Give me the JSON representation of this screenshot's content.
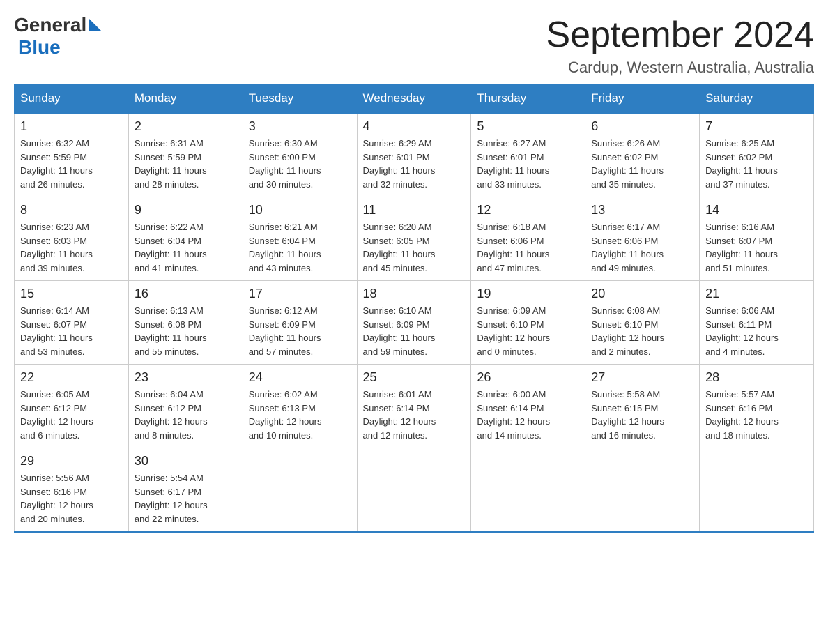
{
  "header": {
    "logo_general": "General",
    "logo_blue": "Blue",
    "main_title": "September 2024",
    "subtitle": "Cardup, Western Australia, Australia"
  },
  "calendar": {
    "weekdays": [
      "Sunday",
      "Monday",
      "Tuesday",
      "Wednesday",
      "Thursday",
      "Friday",
      "Saturday"
    ],
    "weeks": [
      [
        {
          "day": "1",
          "sunrise": "6:32 AM",
          "sunset": "5:59 PM",
          "daylight": "11 hours and 26 minutes."
        },
        {
          "day": "2",
          "sunrise": "6:31 AM",
          "sunset": "5:59 PM",
          "daylight": "11 hours and 28 minutes."
        },
        {
          "day": "3",
          "sunrise": "6:30 AM",
          "sunset": "6:00 PM",
          "daylight": "11 hours and 30 minutes."
        },
        {
          "day": "4",
          "sunrise": "6:29 AM",
          "sunset": "6:01 PM",
          "daylight": "11 hours and 32 minutes."
        },
        {
          "day": "5",
          "sunrise": "6:27 AM",
          "sunset": "6:01 PM",
          "daylight": "11 hours and 33 minutes."
        },
        {
          "day": "6",
          "sunrise": "6:26 AM",
          "sunset": "6:02 PM",
          "daylight": "11 hours and 35 minutes."
        },
        {
          "day": "7",
          "sunrise": "6:25 AM",
          "sunset": "6:02 PM",
          "daylight": "11 hours and 37 minutes."
        }
      ],
      [
        {
          "day": "8",
          "sunrise": "6:23 AM",
          "sunset": "6:03 PM",
          "daylight": "11 hours and 39 minutes."
        },
        {
          "day": "9",
          "sunrise": "6:22 AM",
          "sunset": "6:04 PM",
          "daylight": "11 hours and 41 minutes."
        },
        {
          "day": "10",
          "sunrise": "6:21 AM",
          "sunset": "6:04 PM",
          "daylight": "11 hours and 43 minutes."
        },
        {
          "day": "11",
          "sunrise": "6:20 AM",
          "sunset": "6:05 PM",
          "daylight": "11 hours and 45 minutes."
        },
        {
          "day": "12",
          "sunrise": "6:18 AM",
          "sunset": "6:06 PM",
          "daylight": "11 hours and 47 minutes."
        },
        {
          "day": "13",
          "sunrise": "6:17 AM",
          "sunset": "6:06 PM",
          "daylight": "11 hours and 49 minutes."
        },
        {
          "day": "14",
          "sunrise": "6:16 AM",
          "sunset": "6:07 PM",
          "daylight": "11 hours and 51 minutes."
        }
      ],
      [
        {
          "day": "15",
          "sunrise": "6:14 AM",
          "sunset": "6:07 PM",
          "daylight": "11 hours and 53 minutes."
        },
        {
          "day": "16",
          "sunrise": "6:13 AM",
          "sunset": "6:08 PM",
          "daylight": "11 hours and 55 minutes."
        },
        {
          "day": "17",
          "sunrise": "6:12 AM",
          "sunset": "6:09 PM",
          "daylight": "11 hours and 57 minutes."
        },
        {
          "day": "18",
          "sunrise": "6:10 AM",
          "sunset": "6:09 PM",
          "daylight": "11 hours and 59 minutes."
        },
        {
          "day": "19",
          "sunrise": "6:09 AM",
          "sunset": "6:10 PM",
          "daylight": "12 hours and 0 minutes."
        },
        {
          "day": "20",
          "sunrise": "6:08 AM",
          "sunset": "6:10 PM",
          "daylight": "12 hours and 2 minutes."
        },
        {
          "day": "21",
          "sunrise": "6:06 AM",
          "sunset": "6:11 PM",
          "daylight": "12 hours and 4 minutes."
        }
      ],
      [
        {
          "day": "22",
          "sunrise": "6:05 AM",
          "sunset": "6:12 PM",
          "daylight": "12 hours and 6 minutes."
        },
        {
          "day": "23",
          "sunrise": "6:04 AM",
          "sunset": "6:12 PM",
          "daylight": "12 hours and 8 minutes."
        },
        {
          "day": "24",
          "sunrise": "6:02 AM",
          "sunset": "6:13 PM",
          "daylight": "12 hours and 10 minutes."
        },
        {
          "day": "25",
          "sunrise": "6:01 AM",
          "sunset": "6:14 PM",
          "daylight": "12 hours and 12 minutes."
        },
        {
          "day": "26",
          "sunrise": "6:00 AM",
          "sunset": "6:14 PM",
          "daylight": "12 hours and 14 minutes."
        },
        {
          "day": "27",
          "sunrise": "5:58 AM",
          "sunset": "6:15 PM",
          "daylight": "12 hours and 16 minutes."
        },
        {
          "day": "28",
          "sunrise": "5:57 AM",
          "sunset": "6:16 PM",
          "daylight": "12 hours and 18 minutes."
        }
      ],
      [
        {
          "day": "29",
          "sunrise": "5:56 AM",
          "sunset": "6:16 PM",
          "daylight": "12 hours and 20 minutes."
        },
        {
          "day": "30",
          "sunrise": "5:54 AM",
          "sunset": "6:17 PM",
          "daylight": "12 hours and 22 minutes."
        },
        null,
        null,
        null,
        null,
        null
      ]
    ],
    "labels": {
      "sunrise": "Sunrise:",
      "sunset": "Sunset:",
      "daylight": "Daylight:"
    }
  }
}
